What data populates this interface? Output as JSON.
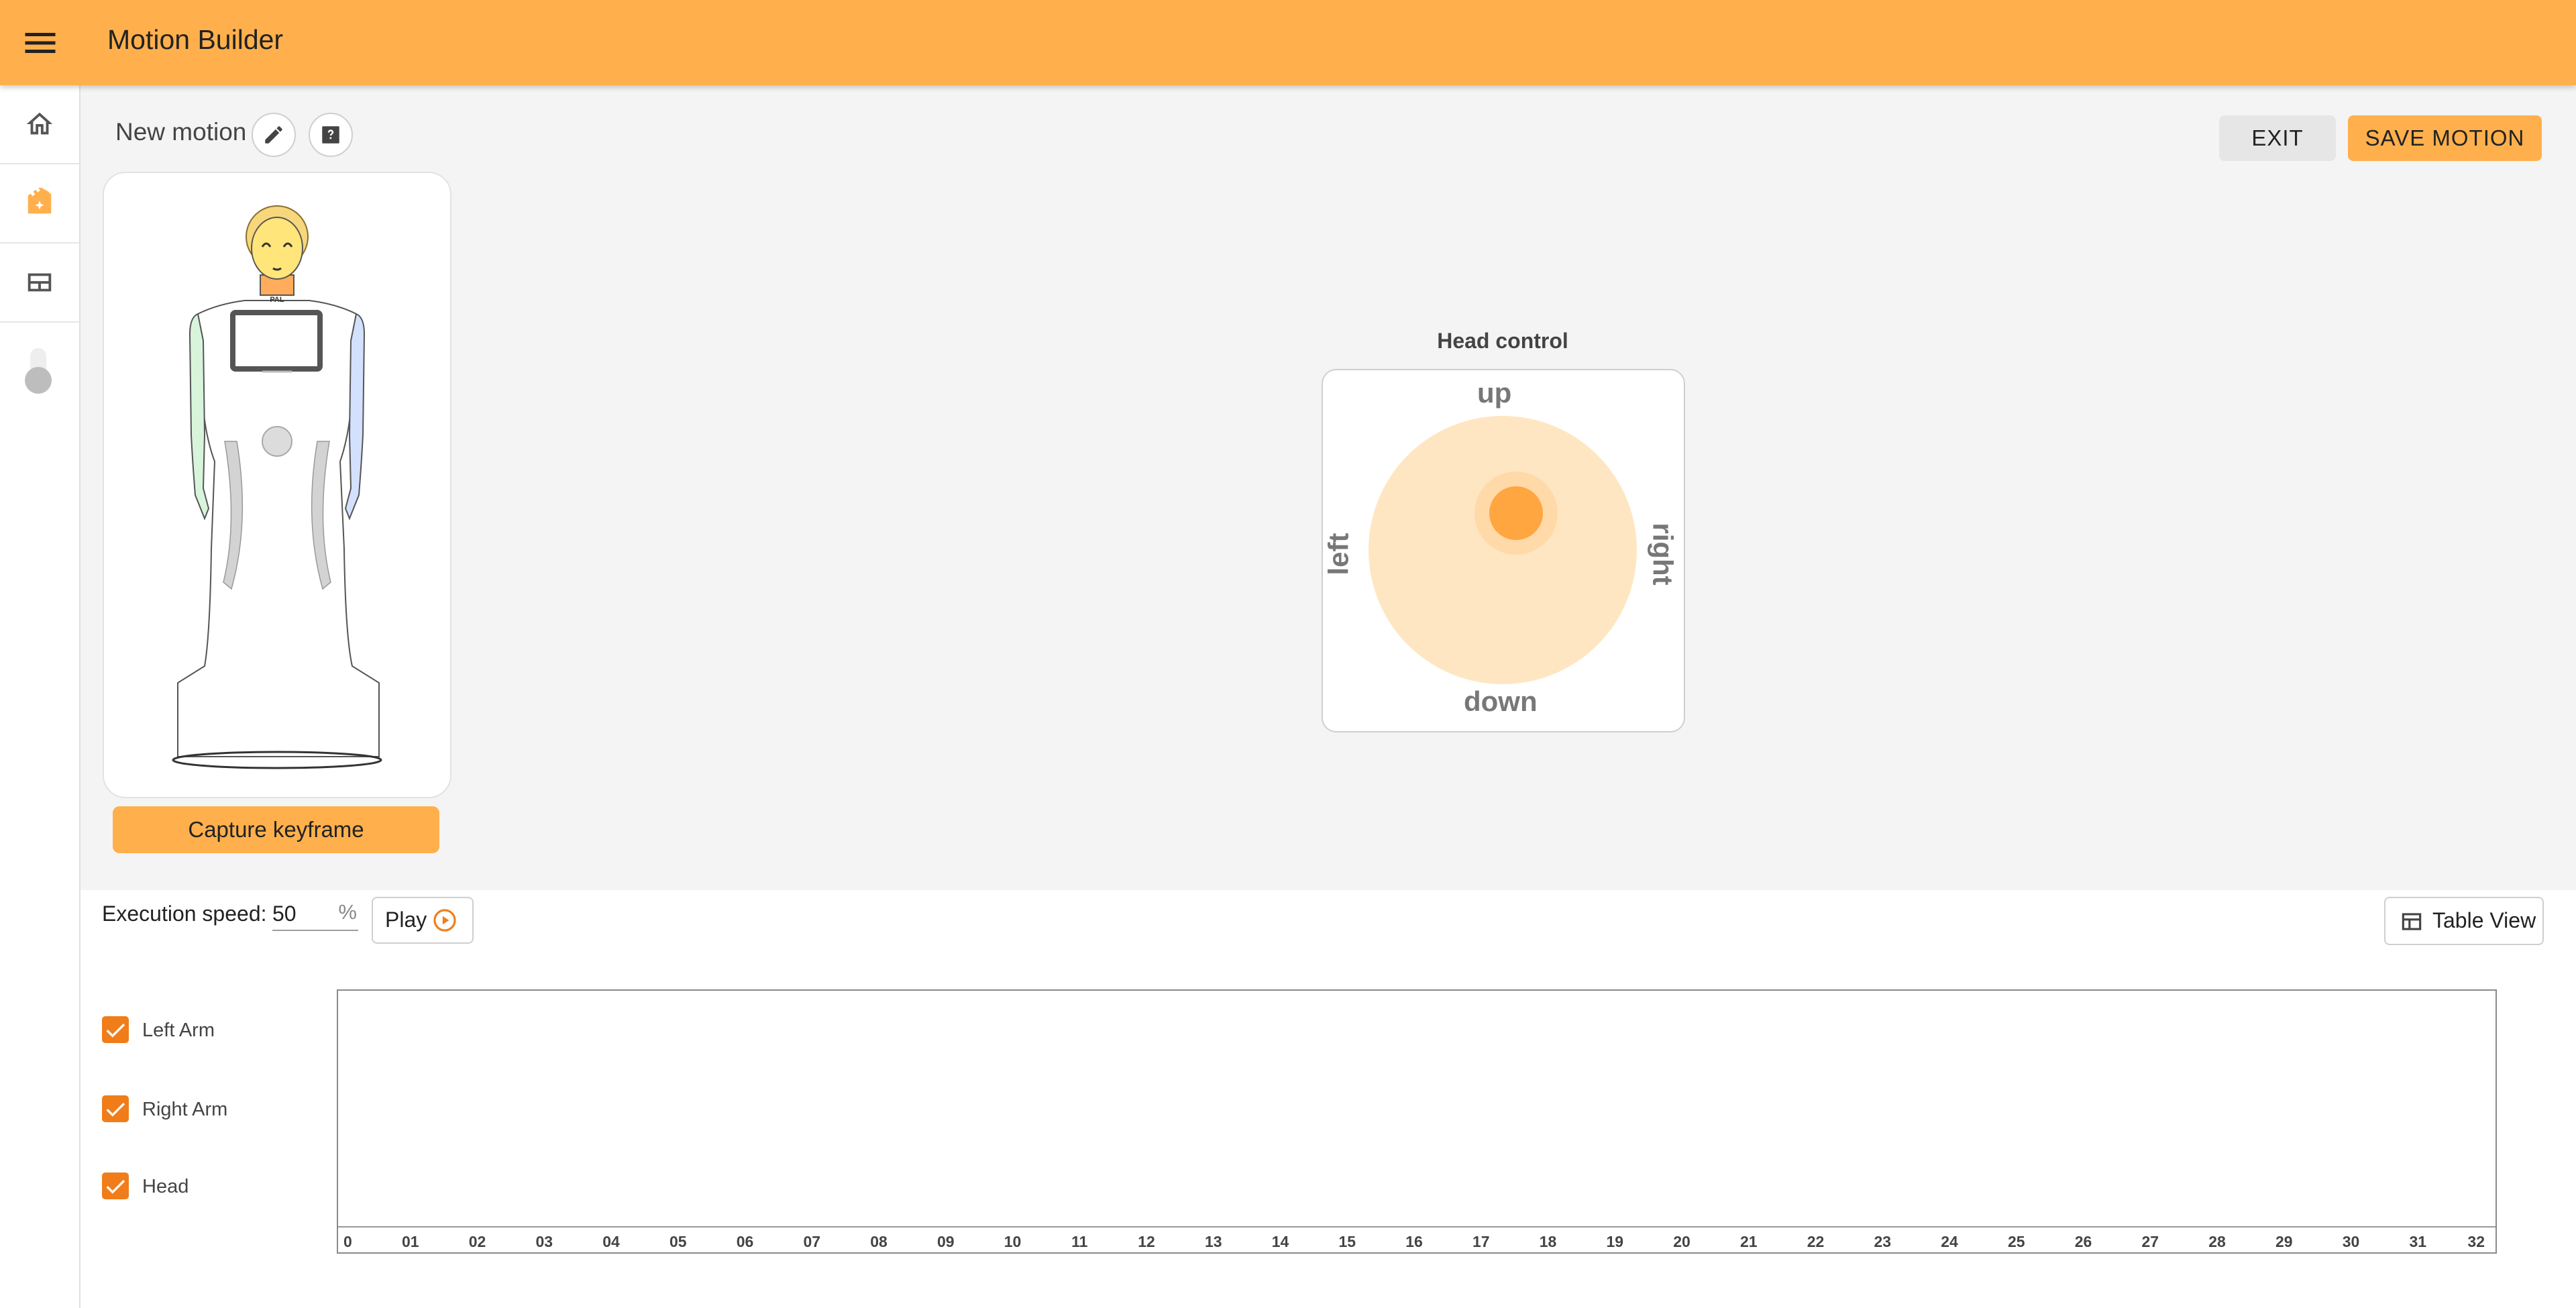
{
  "app": {
    "title": "Motion Builder"
  },
  "colors": {
    "accent": "#ffb04d",
    "checkbox": "#f07d1a",
    "joystick_base": "#ffe6c2",
    "joystick_knob": "#ffa641"
  },
  "sidebar": {
    "items": [
      {
        "name": "home",
        "icon": "home-icon"
      },
      {
        "name": "motion-builder",
        "icon": "movie-sparkle-icon",
        "active": true
      },
      {
        "name": "layout",
        "icon": "dashboard-layout-icon"
      }
    ],
    "toggle": {
      "icon": "toggle-switch-icon",
      "on": false
    }
  },
  "motion": {
    "name": "New motion",
    "edit_icon": "pencil-icon",
    "help_icon": "help-box-icon"
  },
  "toolbar": {
    "exit_label": "EXIT",
    "save_label": "SAVE MOTION"
  },
  "robot": {
    "chest_text": "PAL",
    "capture_label": "Capture keyframe"
  },
  "head_control": {
    "title": "Head control",
    "up": "up",
    "down": "down",
    "left": "left",
    "right": "right"
  },
  "playback": {
    "speed_label": "Execution speed:",
    "speed_value": "50",
    "speed_unit": "%",
    "play_label": "Play",
    "play_icon": "play-circle-outline-icon",
    "table_view_label": "Table View",
    "table_view_icon": "table-icon"
  },
  "groups": [
    {
      "label": "Left Arm",
      "checked": true
    },
    {
      "label": "Right Arm",
      "checked": true
    },
    {
      "label": "Head",
      "checked": true
    }
  ],
  "timeline": {
    "ticks": [
      "0",
      "01",
      "02",
      "03",
      "04",
      "05",
      "06",
      "07",
      "08",
      "09",
      "10",
      "11",
      "12",
      "13",
      "14",
      "15",
      "16",
      "17",
      "18",
      "19",
      "20",
      "21",
      "22",
      "23",
      "24",
      "25",
      "26",
      "27",
      "28",
      "29",
      "30",
      "31",
      "32"
    ]
  }
}
